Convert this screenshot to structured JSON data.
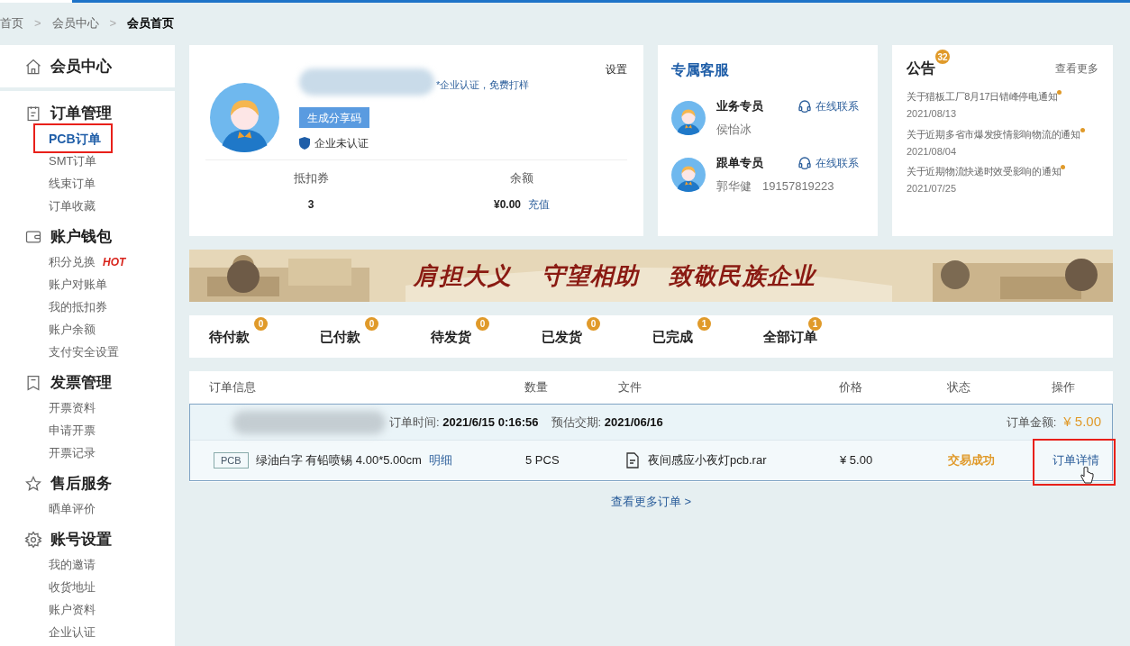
{
  "breadcrumb": [
    {
      "label": "首页",
      "selected": false
    },
    {
      "label": "会员中心",
      "selected": false
    },
    {
      "label": "会员首页",
      "selected": true
    }
  ],
  "breadcrumb_separator": ">",
  "sidebar": {
    "home": "会员中心",
    "groups": [
      {
        "title": "订单管理",
        "kind": "order",
        "items": [
          {
            "label": "PCB订单",
            "selected": true,
            "highlighted": true
          },
          {
            "label": "SMT订单",
            "selected": false,
            "highlighted": false
          },
          {
            "label": "线束订单",
            "selected": false,
            "highlighted": false
          },
          {
            "label": "订单收藏",
            "selected": false,
            "highlighted": false
          }
        ]
      },
      {
        "title": "账户钱包",
        "kind": "wallet",
        "items": [
          {
            "label": "积分兑换",
            "badge": "HOT",
            "selected": false,
            "highlighted": false
          },
          {
            "label": "账户对账单",
            "selected": false,
            "highlighted": false
          },
          {
            "label": "我的抵扣券",
            "selected": false,
            "highlighted": false
          },
          {
            "label": "账户余额",
            "selected": false,
            "highlighted": false
          },
          {
            "label": "支付安全设置",
            "selected": false,
            "highlighted": false
          }
        ]
      },
      {
        "title": "发票管理",
        "kind": "invoice",
        "items": [
          {
            "label": "开票资料",
            "selected": false,
            "highlighted": false
          },
          {
            "label": "申请开票",
            "selected": false,
            "highlighted": false
          },
          {
            "label": "开票记录",
            "selected": false,
            "highlighted": false
          }
        ]
      },
      {
        "title": "售后服务",
        "kind": "service",
        "items": [
          {
            "label": "晒单评价",
            "selected": false,
            "highlighted": false
          }
        ]
      },
      {
        "title": "账号设置",
        "kind": "settings",
        "items": [
          {
            "label": "我的邀请",
            "selected": false,
            "highlighted": false
          },
          {
            "label": "收货地址",
            "selected": false,
            "highlighted": false
          },
          {
            "label": "账户资料",
            "selected": false,
            "highlighted": false
          },
          {
            "label": "企业认证",
            "selected": false,
            "highlighted": false
          }
        ]
      }
    ]
  },
  "profile": {
    "settings": "设置",
    "promo": "*企业认证，免费打样",
    "share_button": "生成分享码",
    "cert_status": "企业未认证",
    "stats": [
      {
        "label": "抵扣券",
        "value": "3"
      },
      {
        "label": "余额",
        "value": "¥0.00",
        "link": "充值"
      }
    ]
  },
  "service": {
    "title": "专属客服",
    "agents": [
      {
        "role": "业务专员",
        "name": "侯怡冰",
        "contact": "在线联系"
      },
      {
        "role": "跟单专员",
        "name": "郭华健",
        "phone": "19157819223",
        "contact": "在线联系"
      }
    ]
  },
  "notices": {
    "title": "公告",
    "count": "32",
    "more": "查看更多",
    "items": [
      {
        "title": "关于猎板工厂8月17日错峰停电通知",
        "date": "2021/08/13",
        "unread": true
      },
      {
        "title": "关于近期多省市爆发疫情影响物流的通知",
        "date": "2021/08/04",
        "unread": true
      },
      {
        "title": "关于近期物流快递时效受影响的通知",
        "date": "2021/07/25",
        "unread": true
      }
    ]
  },
  "banner": {
    "slogans": [
      "肩担大义",
      "守望相助",
      "致敬民族企业"
    ]
  },
  "order_tabs": [
    {
      "label": "待付款",
      "count": "0"
    },
    {
      "label": "已付款",
      "count": "0"
    },
    {
      "label": "待发货",
      "count": "0"
    },
    {
      "label": "已发货",
      "count": "0"
    },
    {
      "label": "已完成",
      "count": "1"
    },
    {
      "label": "全部订单",
      "count": "1"
    }
  ],
  "orders": {
    "columns": [
      "订单信息",
      "数量",
      "文件",
      "价格",
      "状态",
      "操作"
    ],
    "order": {
      "time_label": "订单时间:",
      "time": "2021/6/15 0:16:56",
      "eta_label": "预估交期:",
      "eta": "2021/06/16",
      "total_label": "订单金额:",
      "total": "¥ 5.00",
      "item": {
        "tag": "PCB",
        "spec": "绿油白字 有铅喷锡 4.00*5.00cm",
        "detail_link": "明细",
        "qty": "5 PCS",
        "file": "夜间感应小夜灯pcb.rar",
        "price": "¥ 5.00",
        "status": "交易成功",
        "action": "订单详情",
        "highlighted": true
      }
    },
    "more": "查看更多订单",
    "more_arrow": ">"
  }
}
